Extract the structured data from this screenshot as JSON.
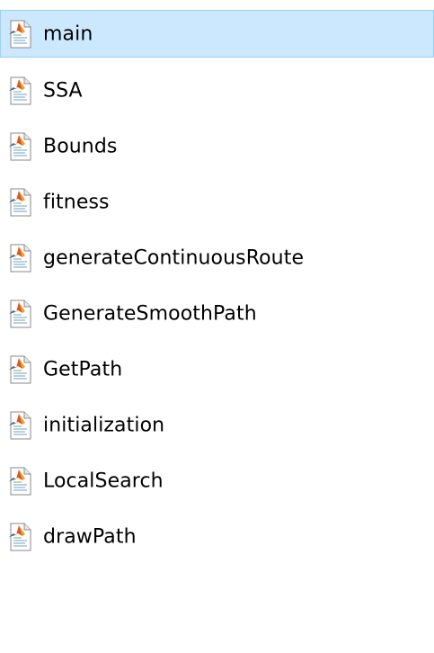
{
  "files": [
    {
      "name": "main",
      "icon": "matlab-file-icon",
      "selected": true
    },
    {
      "name": "SSA",
      "icon": "matlab-file-icon",
      "selected": false
    },
    {
      "name": "Bounds",
      "icon": "matlab-file-icon",
      "selected": false
    },
    {
      "name": "fitness",
      "icon": "matlab-file-icon",
      "selected": false
    },
    {
      "name": "generateContinuousRoute",
      "icon": "matlab-file-icon",
      "selected": false
    },
    {
      "name": "GenerateSmoothPath",
      "icon": "matlab-file-icon",
      "selected": false
    },
    {
      "name": "GetPath",
      "icon": "matlab-file-icon",
      "selected": false
    },
    {
      "name": "initialization",
      "icon": "matlab-file-icon",
      "selected": false
    },
    {
      "name": "LocalSearch",
      "icon": "matlab-file-icon",
      "selected": false
    },
    {
      "name": "drawPath",
      "icon": "matlab-file-icon",
      "selected": false
    }
  ],
  "colors": {
    "selection_bg": "#cce8ff",
    "selection_border": "#99d1ff",
    "text": "#000000"
  }
}
